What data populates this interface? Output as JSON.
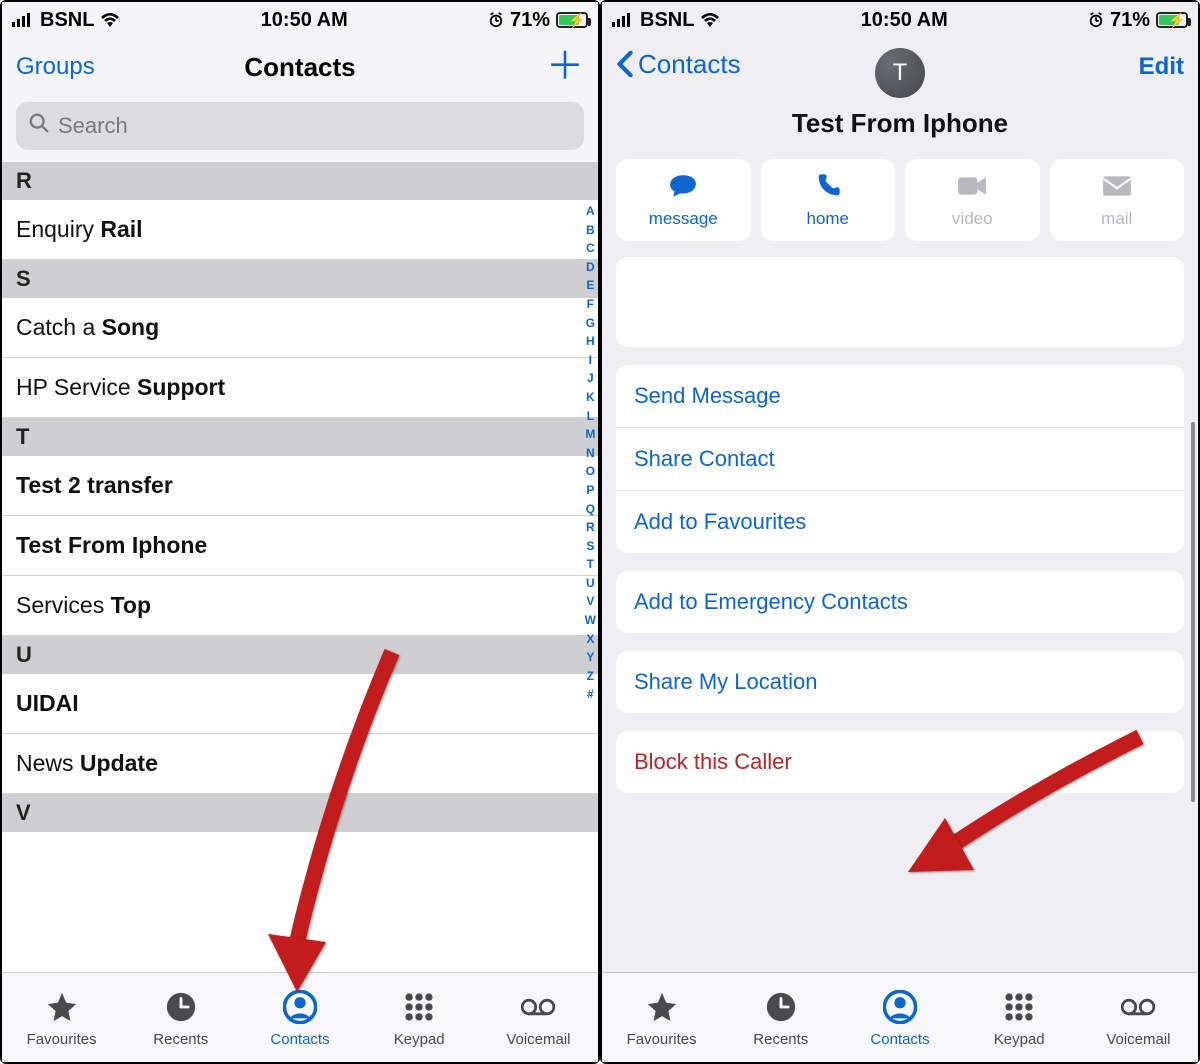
{
  "status": {
    "carrier": "BSNL",
    "time": "10:50 AM",
    "battery": "71%"
  },
  "left": {
    "nav": {
      "groups": "Groups",
      "title": "Contacts"
    },
    "search_placeholder": "Search",
    "sections": [
      {
        "letter": "R",
        "items": [
          {
            "pre": "Enquiry ",
            "bold": "Rail"
          }
        ]
      },
      {
        "letter": "S",
        "items": [
          {
            "pre": "Catch a ",
            "bold": "Song"
          },
          {
            "pre": "HP Service ",
            "bold": "Support"
          }
        ]
      },
      {
        "letter": "T",
        "items": [
          {
            "pre": "",
            "bold": "Test 2 transfer"
          },
          {
            "pre": "",
            "bold": "Test From Iphone"
          },
          {
            "pre": "Services ",
            "bold": "Top"
          }
        ]
      },
      {
        "letter": "U",
        "items": [
          {
            "pre": "",
            "bold": "UIDAI"
          },
          {
            "pre": "News ",
            "bold": "Update"
          }
        ]
      },
      {
        "letter": "V",
        "items": []
      }
    ],
    "index": [
      "A",
      "B",
      "C",
      "D",
      "E",
      "F",
      "G",
      "H",
      "I",
      "J",
      "K",
      "L",
      "M",
      "N",
      "O",
      "P",
      "Q",
      "R",
      "S",
      "T",
      "U",
      "V",
      "W",
      "X",
      "Y",
      "Z",
      "#"
    ]
  },
  "right": {
    "nav": {
      "back": "Contacts",
      "edit": "Edit"
    },
    "avatar_letter": "T",
    "contact_name": "Test From Iphone",
    "actions": [
      {
        "label": "message",
        "tone": "blue",
        "icon": "message"
      },
      {
        "label": "home",
        "tone": "blue",
        "icon": "phone"
      },
      {
        "label": "video",
        "tone": "gray",
        "icon": "video"
      },
      {
        "label": "mail",
        "tone": "gray",
        "icon": "mail"
      }
    ],
    "group1": [
      "Send Message",
      "Share Contact",
      "Add to Favourites"
    ],
    "group2": [
      "Add to Emergency Contacts"
    ],
    "group3": [
      "Share My Location"
    ],
    "group4": [
      "Block this Caller"
    ]
  },
  "tabs": [
    {
      "label": "Favourites",
      "icon": "star"
    },
    {
      "label": "Recents",
      "icon": "clock"
    },
    {
      "label": "Contacts",
      "icon": "contact",
      "active": true
    },
    {
      "label": "Keypad",
      "icon": "keypad"
    },
    {
      "label": "Voicemail",
      "icon": "voicemail"
    }
  ]
}
